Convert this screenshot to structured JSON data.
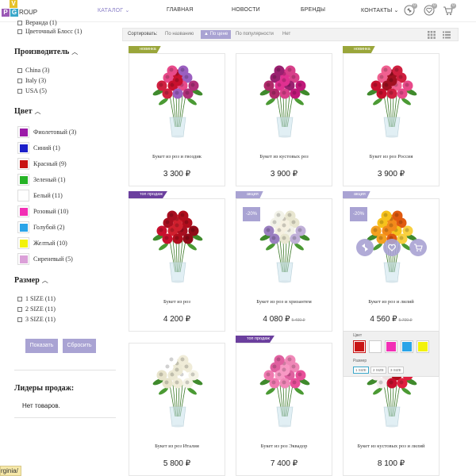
{
  "header": {
    "logo": {
      "v": "V",
      "p": "P",
      "g": "G",
      "rest": "ROUP"
    },
    "nav": [
      {
        "label": "КАТАЛОГ ⌄",
        "active": true
      },
      {
        "label": "ГЛАВНАЯ"
      },
      {
        "label": "НОВОСТИ"
      },
      {
        "label": "БРЕНДЫ"
      },
      {
        "label": "КОНТАКТЫ ⌄"
      }
    ],
    "icons": [
      {
        "name": "compare-icon",
        "badge": "0"
      },
      {
        "name": "favorites-icon",
        "badge": "0"
      },
      {
        "name": "cart-icon",
        "badge": "0"
      }
    ]
  },
  "sidebar": {
    "type_items": [
      "Веранда (1)",
      "Цветочный Блосс (1)"
    ],
    "manufacturer_title": "Производитель",
    "manufacturers": [
      "China (3)",
      "Italy (3)",
      "USA (5)"
    ],
    "color_title": "Цвет",
    "colors": [
      {
        "label": "Фиолетовый (3)",
        "hex": "#9b1aa8"
      },
      {
        "label": "Синий (1)",
        "hex": "#1b1fc9"
      },
      {
        "label": "Красный (9)",
        "hex": "#c81414"
      },
      {
        "label": "Зеленый (1)",
        "hex": "#26b326"
      },
      {
        "label": "Белый (11)",
        "hex": "#ffffff"
      },
      {
        "label": "Розовый (10)",
        "hex": "#f22fb5"
      },
      {
        "label": "Голубой (2)",
        "hex": "#2aa4e8"
      },
      {
        "label": "Желтый (10)",
        "hex": "#f2f20a"
      },
      {
        "label": "Сиреневый (5)",
        "hex": "#dba0d8"
      }
    ],
    "size_title": "Размер",
    "sizes": [
      "1 SIZE (11)",
      "2 SIZE (11)",
      "3 SIZE (11)"
    ],
    "show_button": "Показать",
    "reset_button": "Сбросить",
    "leaders_title": "Лидеры продаж:",
    "no_items": "Нет товаров."
  },
  "sortbar": {
    "label": "Сортировать:",
    "options": [
      "По названию",
      "▲ По цене",
      "По популярности",
      "Нет"
    ],
    "active_index": 1
  },
  "products": [
    {
      "name": "Букет из роз и гвоздик",
      "price": "3 300 ₽",
      "ribbon": "новинка",
      "ribbon_type": "new",
      "flowers": [
        "#c8102e",
        "#e84a8a",
        "#9b5fc0",
        "#d02040",
        "#b0307a"
      ]
    },
    {
      "name": "Букет из кустовых роз",
      "price": "3 900 ₽",
      "ribbon": "",
      "ribbon_type": "",
      "flowers": [
        "#c0187a",
        "#e03090",
        "#9a2070",
        "#d8408a",
        "#b02a6a"
      ]
    },
    {
      "name": "Букет из роз Россия",
      "price": "3 900 ₽",
      "ribbon": "новинка",
      "ribbon_type": "new",
      "flowers": [
        "#c8102e",
        "#e84a8a",
        "#a01020",
        "#f06090",
        "#d02040"
      ]
    },
    {
      "name": "Букет из роз",
      "price": "4 200 ₽",
      "ribbon": "топ продаж",
      "ribbon_type": "top",
      "flowers": [
        "#b00d1c",
        "#c8102e",
        "#900a18",
        "#d0202e",
        "#a80f20"
      ]
    },
    {
      "name": "Букет из роз и хризантем",
      "price": "4 080 ₽",
      "old_price": "5 400 ₽",
      "discount": "-20%",
      "ribbon": "акция",
      "ribbon_type": "sale",
      "flowers": [
        "#f2f2e8",
        "#e8e6d0",
        "#9a7fc0",
        "#c0b0d8",
        "#f5f0e0"
      ]
    },
    {
      "name": "Букет из роз и лилий",
      "price": "4 560 ₽",
      "old_price": "5 700 ₽",
      "discount": "-20%",
      "ribbon": "акция",
      "ribbon_type": "sale",
      "flowers": [
        "#f28a1a",
        "#f6c21c",
        "#e05a10",
        "#f4a020",
        "#f8d040"
      ]
    },
    {
      "name": "Букет из роз Италия",
      "price": "5 800 ₽",
      "ribbon": "",
      "ribbon_type": "",
      "flowers": [
        "#f5f3e6",
        "#ece9d4",
        "#ffffff",
        "#f0ecd8",
        "#e8e4cc"
      ]
    },
    {
      "name": "Букет из роз Эквадор",
      "price": "7 400 ₽",
      "ribbon": "топ продаж",
      "ribbon_type": "top",
      "flowers": [
        "#f07ab0",
        "#e8509a",
        "#f898c4",
        "#e060a0",
        "#f088b8"
      ]
    },
    {
      "name": "Букет из кустовых роз и лилий",
      "price": "8 100 ₽",
      "ribbon": "",
      "ribbon_type": "",
      "flowers": [
        "#c8102e",
        "#f5f0f0",
        "#e02040",
        "#f0e0e0",
        "#b00d1c"
      ]
    }
  ],
  "hover_panel": {
    "color_label": "Цвет",
    "swatches": [
      "#c81414",
      "#ffffff",
      "#f22fb5",
      "#2aa4e8",
      "#f2f20a"
    ],
    "size_label": "Размер",
    "sizes": [
      "1 SIZE",
      "2 SIZE",
      "3 SIZE"
    ]
  },
  "status_bar": "rginia/"
}
